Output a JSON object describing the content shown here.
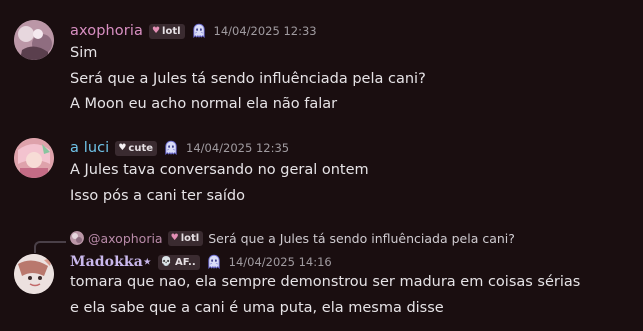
{
  "messages": [
    {
      "author": "axophoria",
      "author_color": "#d88fc2",
      "tag": "lotl",
      "timestamp": "14/04/2025 12:33",
      "lines": [
        "Sim",
        "Será que a Jules tá sendo influênciada pela cani?",
        "A Moon eu acho normal ela não falar"
      ]
    },
    {
      "author": "a luci",
      "author_color": "#6fc3e8",
      "tag": "cute",
      "timestamp": "14/04/2025 12:35",
      "lines": [
        "A Jules tava conversando no geral ontem",
        "Isso pós a cani ter saído"
      ]
    },
    {
      "reply": {
        "name": "@axophoria",
        "tag": "lotl",
        "text": "Será que a Jules tá sendo influênciada pela cani?"
      },
      "author": "Madokka⋆",
      "author_color": "#c9b8ec",
      "tag": "AF..",
      "timestamp": "14/04/2025 14:16",
      "lines": [
        "tomara que nao, ela sempre demonstrou ser madura em coisas sérias",
        "e ela sabe que a cani é uma puta, ela mesma disse"
      ]
    }
  ],
  "icons": {
    "ghost": "ghost-icon",
    "heart": "heart-icon",
    "skull": "skull-icon"
  },
  "colors": {
    "background": "#1a0e10",
    "timestamp": "#a09ba0",
    "tag_background": "#3a2b30"
  }
}
